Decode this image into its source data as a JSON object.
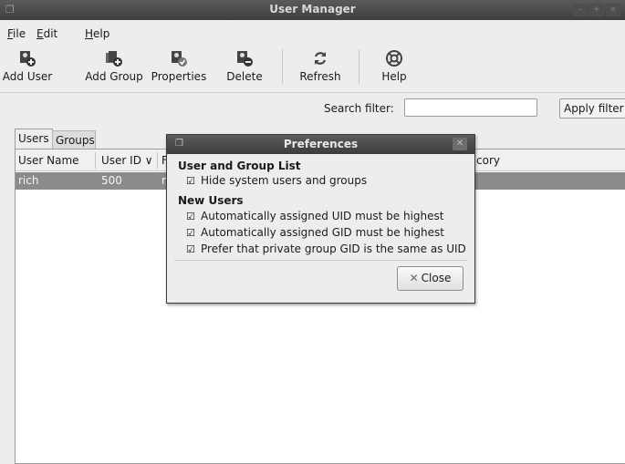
{
  "window": {
    "title": "User Manager"
  },
  "menu": {
    "file": "File",
    "edit": "Edit",
    "help": "Help"
  },
  "toolbar": {
    "add_user": "Add User",
    "add_group": "Add Group",
    "properties": "Properties",
    "delete": "Delete",
    "refresh": "Refresh",
    "help": "Help"
  },
  "search": {
    "label": "Search filter:",
    "value": "",
    "apply": "Apply filter"
  },
  "tabs": [
    {
      "label": "Users"
    },
    {
      "label": "Groups"
    }
  ],
  "table": {
    "columns": [
      "User Name",
      "User ID",
      "F",
      "cory"
    ],
    "sort_indicator": "∨",
    "rows": [
      {
        "name": "rich",
        "uid": "500",
        "partial": "ri"
      }
    ]
  },
  "dialog": {
    "title": "Preferences",
    "section1": "User and Group List",
    "opt_hide": "Hide system users and groups",
    "section2": "New Users",
    "opt_uid": "Automatically assigned UID must be highest",
    "opt_gid": "Automatically assigned GID must be highest",
    "opt_private": "Prefer that private group GID is the same as UID",
    "close": "Close",
    "checks": [
      true,
      true,
      true,
      true
    ]
  },
  "icons": [
    "window-icon",
    "add-user-icon",
    "add-group-icon",
    "properties-icon",
    "delete-icon",
    "refresh-icon",
    "help-icon",
    "close-icon",
    "checkbox-icon"
  ]
}
